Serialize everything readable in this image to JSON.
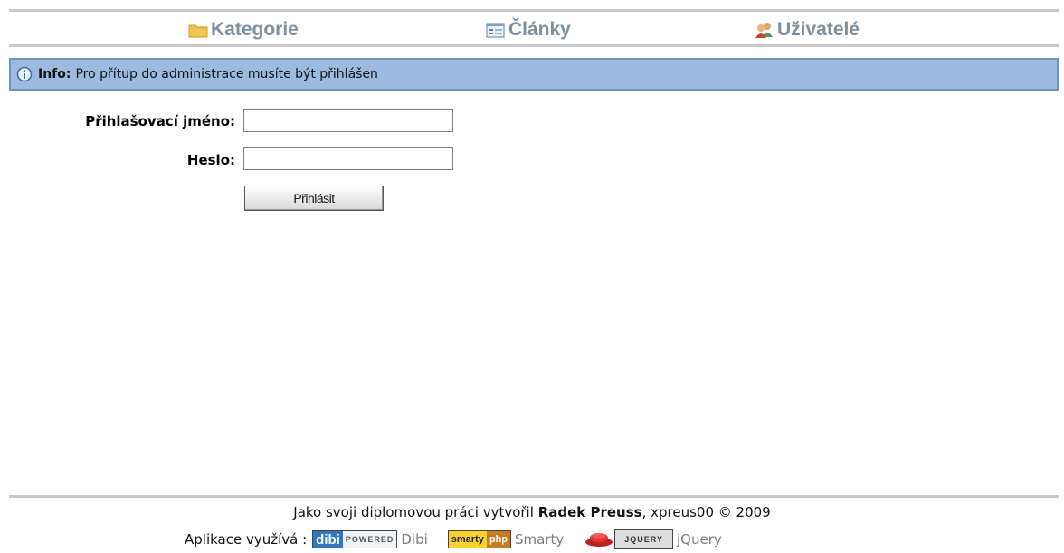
{
  "nav": {
    "items": [
      {
        "label": "Kategorie",
        "icon": "folder-icon"
      },
      {
        "label": "Články",
        "icon": "articles-icon"
      },
      {
        "label": "Uživatelé",
        "icon": "users-icon"
      }
    ]
  },
  "info": {
    "label": "Info:",
    "message": "Pro přítup do administrace musíte být přihlášen",
    "icon": "info-icon"
  },
  "login": {
    "username_label": "Přihlašovací jméno:",
    "password_label": "Heslo:",
    "username_value": "",
    "password_value": "",
    "submit_label": "Přihlásit"
  },
  "footer": {
    "credit_prefix": "Jako svoji diplomovou práci vytvořil",
    "author": "Radek Preuss",
    "credit_suffix": ", xpreus00 © 2009",
    "uses_label": "Aplikace využívá :",
    "tech": [
      {
        "badge_a": "dibi",
        "badge_b": "POWERED",
        "name": "Dibi"
      },
      {
        "badge_a": "smarty",
        "badge_b": "php",
        "name": "Smarty"
      },
      {
        "badge_b": "JQUERY",
        "name": "jQuery"
      }
    ]
  },
  "colors": {
    "nav_text": "#7a8fa0",
    "info_bg": "#9bbbe0",
    "info_border": "#6f94c2",
    "divider": "#c9c9c9"
  }
}
